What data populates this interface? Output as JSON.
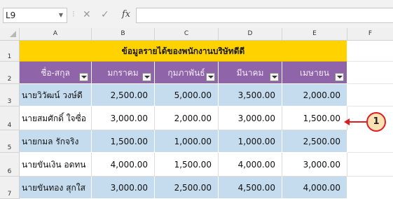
{
  "formula_bar": {
    "name_box": "L9",
    "name_box_arrow": "▼",
    "separator": "⁝",
    "cancel_icon": "✕",
    "enter_icon": "✓",
    "fx_label": "fx",
    "formula": ""
  },
  "columns": [
    "A",
    "B",
    "C",
    "D",
    "E",
    "F"
  ],
  "rows": [
    "1",
    "2",
    "3",
    "4",
    "5",
    "6",
    "7"
  ],
  "sheet": {
    "title": "ข้อมูลรายได้ของพนักงานบริษัทดีดี",
    "headers": [
      "ชื่อ-สกุล",
      "มกราคม",
      "กุมภาพันธ์",
      "มีนาคม",
      "เมษายน"
    ],
    "data": [
      {
        "name": "นายวิวัฒน์ วงษ์ดี",
        "jan": "2,500.00",
        "feb": "5,000.00",
        "mar": "3,500.00",
        "apr": "2,000.00"
      },
      {
        "name": "นายสมศักดิ์ ใจซื่อ",
        "jan": "3,000.00",
        "feb": "2,000.00",
        "mar": "3,000.00",
        "apr": "1,500.00"
      },
      {
        "name": "นายกมล รักจริง",
        "jan": "1,500.00",
        "feb": "1,000.00",
        "mar": "1,000.00",
        "apr": "2,500.00"
      },
      {
        "name": "นายขันเงิน อดทน",
        "jan": "4,000.00",
        "feb": "1,500.00",
        "mar": "4,000.00",
        "apr": "3,000.00"
      },
      {
        "name": "นายขันทอง สุกใส",
        "jan": "3,000.00",
        "feb": "2,500.00",
        "mar": "4,500.00",
        "apr": "4,000.00"
      }
    ]
  },
  "callout": {
    "label": "1",
    "color": "#e11b22"
  },
  "colors": {
    "title_bg": "#ffd200",
    "header_bg": "#8f64a8",
    "band_bg": "#c5dcef"
  }
}
